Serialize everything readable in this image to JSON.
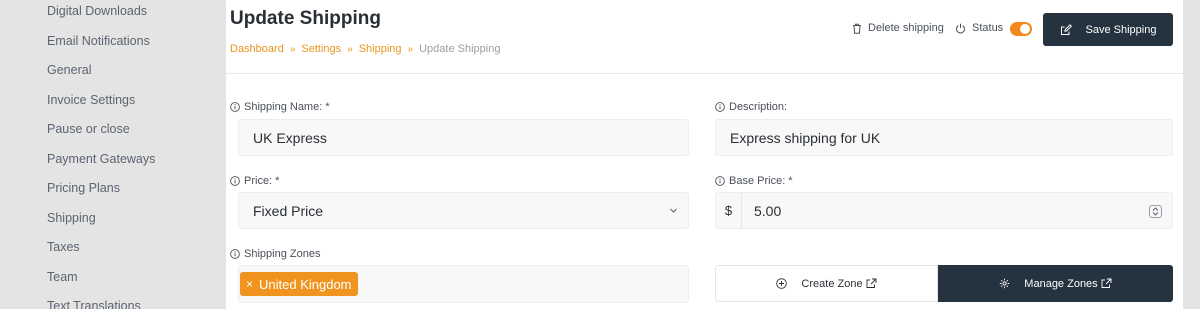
{
  "sidebar": {
    "items": [
      {
        "label": "Digital Downloads"
      },
      {
        "label": "Email Notifications"
      },
      {
        "label": "General"
      },
      {
        "label": "Invoice Settings"
      },
      {
        "label": "Pause or close"
      },
      {
        "label": "Payment Gateways"
      },
      {
        "label": "Pricing Plans"
      },
      {
        "label": "Shipping"
      },
      {
        "label": "Taxes"
      },
      {
        "label": "Team"
      },
      {
        "label": "Text Translations"
      }
    ]
  },
  "header": {
    "title": "Update Shipping",
    "breadcrumb": {
      "dashboard": "Dashboard",
      "settings": "Settings",
      "shipping": "Shipping",
      "current": "Update Shipping",
      "separator": "»"
    },
    "delete_label": "Delete shipping",
    "status_label": "Status",
    "status_on": true,
    "save_label": "Save Shipping"
  },
  "form": {
    "name_label": "Shipping Name: *",
    "name_value": "UK Express",
    "description_label": "Description:",
    "description_value": "Express shipping for UK",
    "price_label": "Price: *",
    "price_value": "Fixed Price",
    "base_price_label": "Base Price: *",
    "currency": "$",
    "base_price_value": "5.00",
    "zones_label": "Shipping Zones",
    "zones": [
      {
        "label": "United Kingdom",
        "remove": "×"
      }
    ],
    "create_zone_label": "Create Zone",
    "manage_zones_label": "Manage Zones"
  },
  "colors": {
    "accent": "#f0941f",
    "dark": "#25323f"
  }
}
